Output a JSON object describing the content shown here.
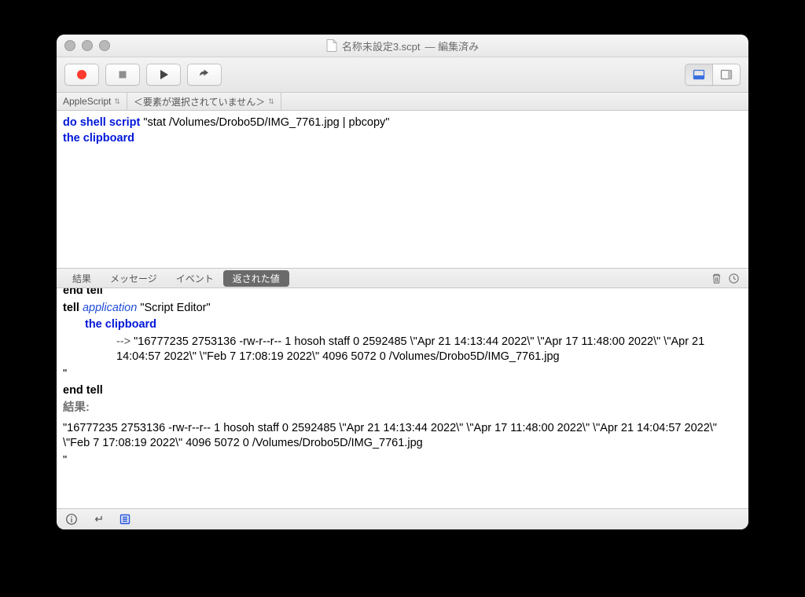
{
  "title": {
    "filename": "名称未設定3.scpt",
    "suffix": "— 編集済み"
  },
  "navbar": {
    "language": "AppleScript",
    "path": "＜要素が選択されていません＞"
  },
  "editor": {
    "line1_kw": "do shell script",
    "line1_str": " \"stat /Volumes/Drobo5D/IMG_7761.jpg | pbcopy\"",
    "line2_kw": "the clipboard"
  },
  "tabs": {
    "t0": "結果",
    "t1": "メッセージ",
    "t2": "イベント",
    "t3": "返された値"
  },
  "log": {
    "tell_kw": "tell",
    "app_it": "application",
    "app_name": " \"Script Editor\"",
    "clip": "the clipboard",
    "arrow": "--> ",
    "stat_out": "\"16777235 2753136 -rw-r--r-- 1 hosoh staff 0 2592485 \\\"Apr 21 14:13:44 2022\\\" \\\"Apr 17 11:48:00 2022\\\" \\\"Apr 21 14:04:57 2022\\\" \\\"Feb  7 17:08:19 2022\\\" 4096 5072 0 /Volumes/Drobo5D/IMG_7761.jpg",
    "stat_close": "\"",
    "end_tell": "end tell",
    "result_label": "結果:",
    "result_body": "\"16777235 2753136 -rw-r--r-- 1 hosoh staff 0 2592485 \\\"Apr 21 14:13:44 2022\\\" \\\"Apr 17 11:48:00 2022\\\" \\\"Apr 21 14:04:57 2022\\\" \\\"Feb  7 17:08:19 2022\\\" 4096 5072 0 /Volumes/Drobo5D/IMG_7761.jpg",
    "result_close": "\""
  }
}
